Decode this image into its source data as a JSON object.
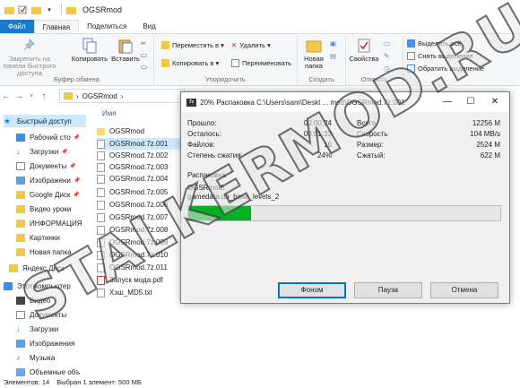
{
  "window": {
    "title": "OGSRmod"
  },
  "ribbon_tabs": [
    "Файл",
    "Главная",
    "Поделиться",
    "Вид"
  ],
  "ribbon": {
    "pin": "Закрепить на панели быстрого доступа",
    "copy": "Копировать",
    "paste": "Вставить",
    "clipboard_group": "Буфер обмена",
    "move_to": "Переместить в",
    "copy_to": "Копировать в",
    "delete": "Удалить",
    "rename": "Переименовать",
    "organize_group": "Упорядочить",
    "new_folder": "Новая папка",
    "create_group": "Создать",
    "properties": "Свойства",
    "open_group": "Открыть",
    "select_all": "Выделить все",
    "select_none": "Снять выделение",
    "invert_selection": "Обратить выделение"
  },
  "address": {
    "path": "OGSRmod"
  },
  "sidebar": {
    "items": [
      "Быстрый доступ",
      "Рабочий сто",
      "Загрузки",
      "Документы",
      "Изображени",
      "Google Диск",
      "Видео уроки",
      "ИНФОРМАЦИЯ",
      "Картинки",
      "Новая папка",
      "Яндекс.Диск",
      "Этот компьютер",
      "Видео",
      "Документы",
      "Загрузки",
      "Изображения",
      "Музыка",
      "Объемные объ"
    ]
  },
  "filelist": {
    "column_name": "Имя",
    "files": [
      "OGSRmod",
      "OGSRmod.7z.001",
      "OGSRmod.7z.002",
      "OGSRmod.7z.003",
      "OGSRmod.7z.004",
      "OGSRmod.7z.005",
      "OGSRmod.7z.006",
      "OGSRmod.7z.007",
      "OGSRmod.7z.008",
      "OGSRmod.7z.009",
      "OGSRmod.7z.010",
      "OGSRmod.7z.011",
      "Запуск мода.pdf",
      "Хэш_MD5.txt"
    ]
  },
  "statusbar": {
    "count": "Элементов: 14",
    "selected": "Выбран 1 элемент: 500 МБ"
  },
  "dialog": {
    "title": "20% Распаковка C:\\Users\\sam\\Deskt ... mod\\OGSRmod.7z.001",
    "elapsed_label": "Прошло:",
    "elapsed": "00:00:24",
    "remaining_label": "Осталось:",
    "remaining": "00:01:33",
    "files_label": "Файлов:",
    "files": "16",
    "ratio_label": "Степень сжатия:",
    "ratio": "24%",
    "total_label": "Всего",
    "total": "12256 M",
    "speed_label": "Скорость",
    "speed": "104 MB/s",
    "size_label": "Размер:",
    "size": "2524 M",
    "packed_label": "Сжатый:",
    "packed": "622 M",
    "action": "Распаковка",
    "current_path": "OGSRmod\\",
    "current_file": "gamedata.db_base_levels_2",
    "progress": 0.2,
    "btn_background": "Фоном",
    "btn_pause": "Пауза",
    "btn_cancel": "Отмена"
  },
  "watermark": "STALKERMOD.RU",
  "colors": {
    "accent": "#1979ca",
    "progress": "#06b025",
    "selection": "#cce8ff"
  }
}
